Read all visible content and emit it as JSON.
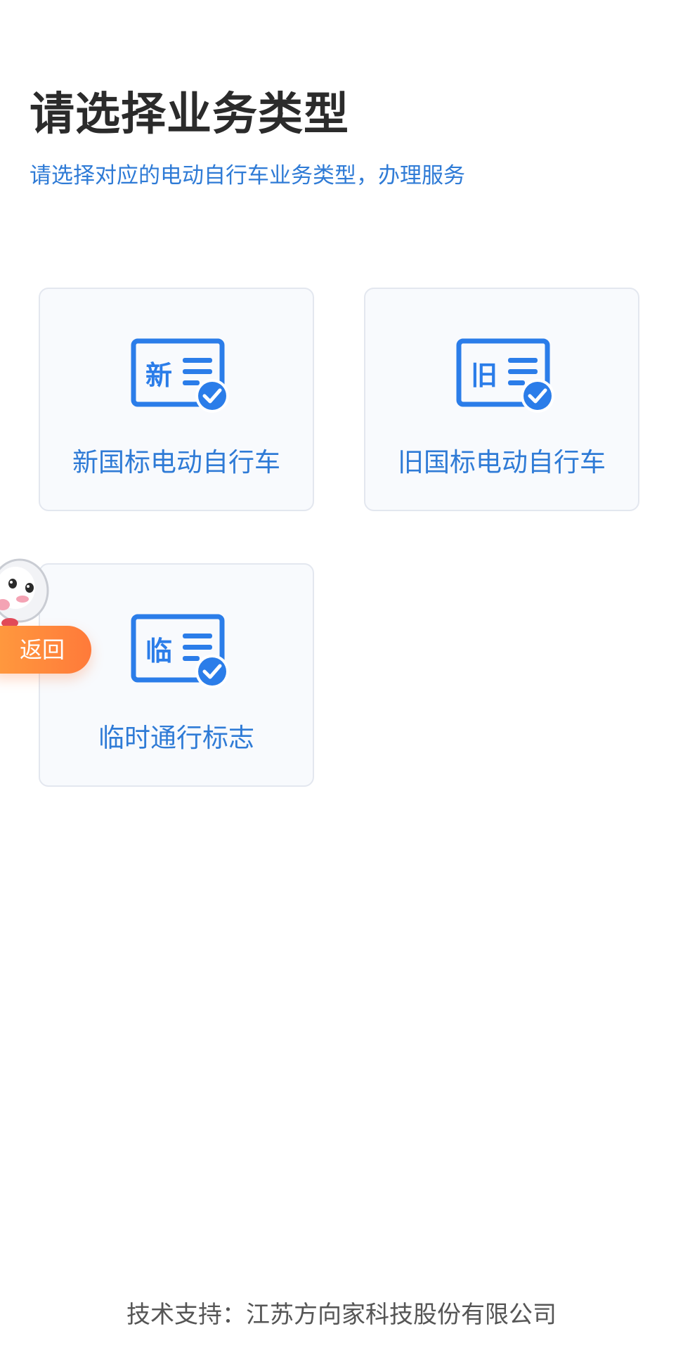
{
  "header": {
    "title": "请选择业务类型",
    "subtitle": "请选择对应的电动自行车业务类型，办理服务"
  },
  "cards": [
    {
      "icon_char": "新",
      "label": "新国标电动自行车",
      "icon": "new-license-check-icon"
    },
    {
      "icon_char": "旧",
      "label": "旧国标电动自行车",
      "icon": "old-license-check-icon"
    },
    {
      "icon_char": "临",
      "label": "临时通行标志",
      "icon": "temporary-license-check-icon"
    }
  ],
  "floating_back": {
    "label": "返回",
    "mascot": "robot-mascot"
  },
  "footer": {
    "text": "技术支持：江苏方向家科技股份有限公司"
  },
  "colors": {
    "accent": "#2f7bd6",
    "icon_blue": "#2b7de9",
    "card_background": "#f8fafd",
    "card_border": "#e3e7ef",
    "back_button": "#ff8a3d",
    "title": "#2b2b2b",
    "footer": "#555555"
  }
}
